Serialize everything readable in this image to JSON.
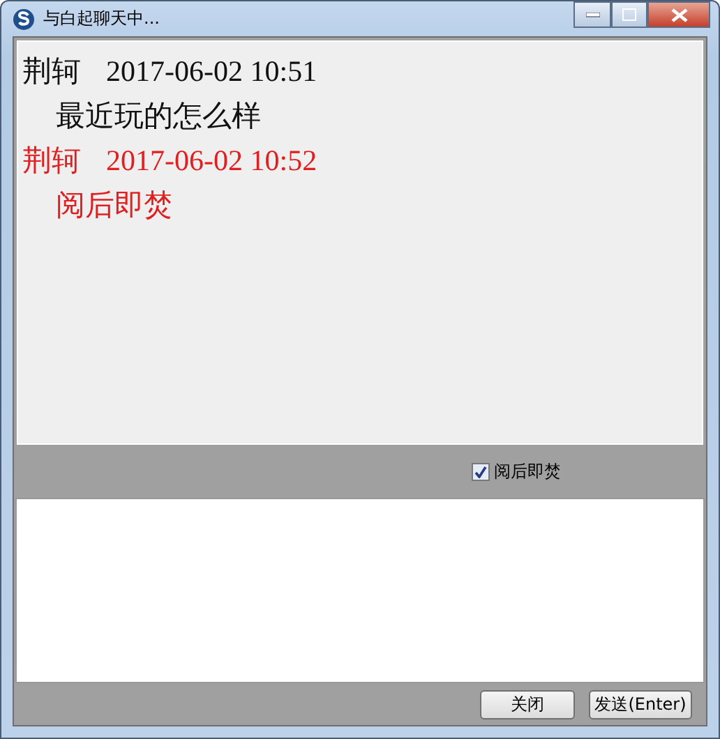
{
  "window": {
    "title": "与白起聊天中..."
  },
  "messages": [
    {
      "sender": "荆轲",
      "time": "2017-06-02 10:51",
      "text": "最近玩的怎么样",
      "color": "#111111"
    },
    {
      "sender": "荆轲",
      "time": "2017-06-02 10:52",
      "text": "阅后即焚",
      "color": "#e02020"
    }
  ],
  "burn_after_reading": {
    "label": "阅后即焚",
    "checked": true
  },
  "buttons": [
    {
      "label": "关闭"
    },
    {
      "label": "发送(Enter)"
    }
  ]
}
